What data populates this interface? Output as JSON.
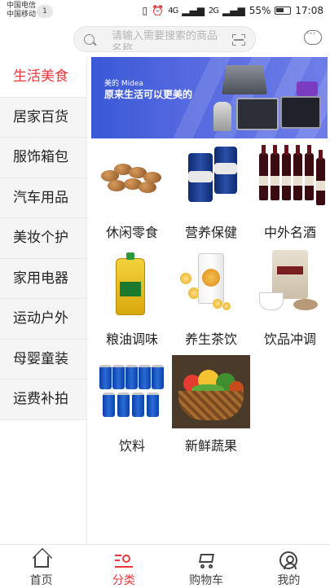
{
  "status_bar": {
    "carrier_1": "中国电信",
    "carrier_2": "中国移动",
    "notification_count": "1",
    "network_1": "4G",
    "network_2": "2G",
    "battery": "55%",
    "time": "17:08"
  },
  "search": {
    "placeholder": "请输入需要搜索的商品名称"
  },
  "sidebar": {
    "items": [
      {
        "label": "生活美食",
        "active": true
      },
      {
        "label": "居家百货",
        "active": false
      },
      {
        "label": "服饰箱包",
        "active": false
      },
      {
        "label": "汽车用品",
        "active": false
      },
      {
        "label": "美妆个护",
        "active": false
      },
      {
        "label": "家用电器",
        "active": false
      },
      {
        "label": "运动户外",
        "active": false
      },
      {
        "label": "母婴童装",
        "active": false
      },
      {
        "label": "运费补拍",
        "active": false
      }
    ]
  },
  "banner": {
    "brand": "美的 Midea",
    "slogan": "原来生活可以更美的"
  },
  "categories": [
    {
      "label": "休闲零食",
      "image": "nuts"
    },
    {
      "label": "营养保健",
      "image": "supplement-bottles"
    },
    {
      "label": "中外名酒",
      "image": "wine-bottles"
    },
    {
      "label": "粮油调味",
      "image": "cooking-oil"
    },
    {
      "label": "养生茶饮",
      "image": "herbal-tea"
    },
    {
      "label": "饮品冲调",
      "image": "coffee"
    },
    {
      "label": "饮料",
      "image": "soda-cans"
    },
    {
      "label": "新鲜蔬果",
      "image": "vegetable-basket"
    }
  ],
  "tabbar": {
    "tabs": [
      {
        "label": "首页",
        "icon": "home-icon",
        "active": false
      },
      {
        "label": "分类",
        "icon": "category-icon",
        "active": true
      },
      {
        "label": "购物车",
        "icon": "cart-icon",
        "active": false
      },
      {
        "label": "我的",
        "icon": "profile-icon",
        "active": false
      }
    ]
  },
  "colors": {
    "accent": "#e8383d",
    "banner": "#4a62dc"
  }
}
